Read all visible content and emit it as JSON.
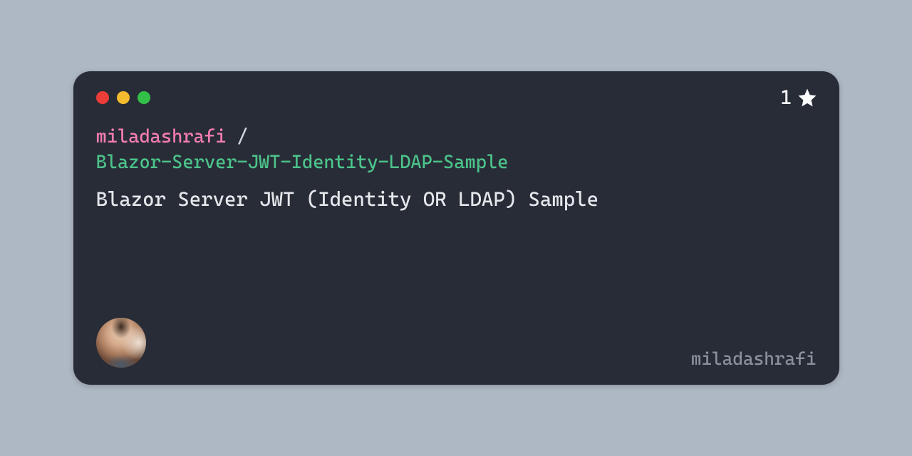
{
  "colors": {
    "background": "#aeb8c4",
    "card": "#282c37",
    "owner": "#f47db0",
    "repo": "#4cc38a",
    "description": "#e4e6ea",
    "username": "#8a919e",
    "dot_red": "#ec3d39",
    "dot_yellow": "#f4bb2e",
    "dot_green": "#33c048"
  },
  "star_count": "1",
  "repo": {
    "owner": "miladashrafi",
    "separator": " /",
    "name": "Blazor-Server-JWT-Identity-LDAP-Sample"
  },
  "description": "Blazor Server JWT (Identity OR LDAP) Sample",
  "username": "miladashrafi"
}
